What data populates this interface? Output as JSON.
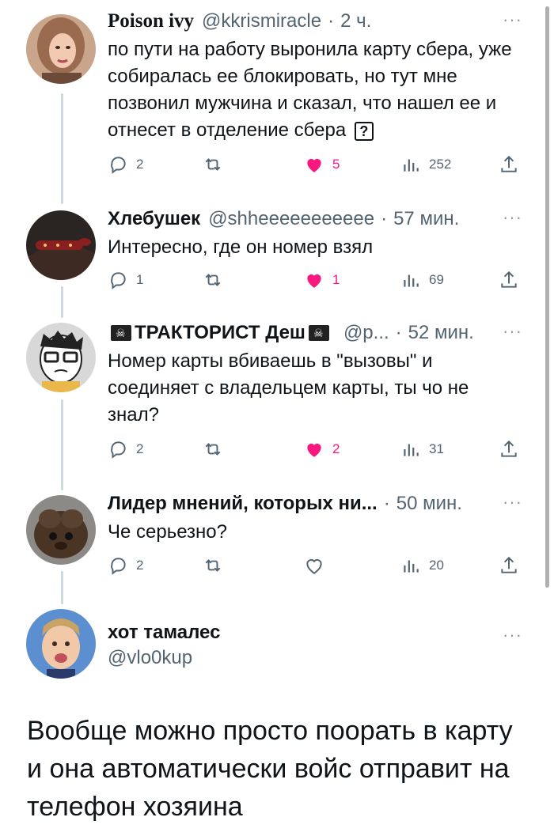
{
  "tweets": [
    {
      "name": "Poison ivy",
      "handle": "@kkrismiracle",
      "time": "2 ч.",
      "text": "по пути на работу выронила карту сбера, уже собиралась ее блокировать, но тут мне позвонил мужчина и сказал, что нашел ее и отнесет в отделение сбера",
      "emoji_badge": "?",
      "replies": "2",
      "retweets": "",
      "likes": "5",
      "views": "252",
      "liked": true
    },
    {
      "name": "Хлебушек",
      "handle": "@shheeeeeeeeeee",
      "time": "57 мин.",
      "text": "Интересно, где он номер взял",
      "replies": "1",
      "retweets": "",
      "likes": "1",
      "views": "69",
      "liked": true
    },
    {
      "name": "ТРАКТОРИСТ Деш",
      "handle": "@р...",
      "time": "52 мин.",
      "text": "Номер карты вбиваешь в \"вызовы\" и соединяет с владельцем карты, ты чо не знал?",
      "replies": "2",
      "retweets": "",
      "likes": "2",
      "views": "31",
      "liked": true
    },
    {
      "name": "Лидер мнений, которых ни...",
      "handle": "",
      "time": "50 мин.",
      "text": "Че серьезно?",
      "replies": "2",
      "retweets": "",
      "likes": "",
      "views": "20",
      "liked": false
    }
  ],
  "main_tweet": {
    "name": "хот тамалес",
    "handle": "@vlo0kup",
    "text": "Вообще можно просто поорать в карту и она автоматически войс отправит на телефон хозяина"
  },
  "more_label": "···",
  "separator": "·",
  "colors": {
    "like": "#f91880",
    "muted": "#536471",
    "thread_line": "#cfd9de"
  },
  "icons": [
    "reply-icon",
    "retweet-icon",
    "heart-icon",
    "views-icon",
    "share-icon",
    "more-icon"
  ]
}
